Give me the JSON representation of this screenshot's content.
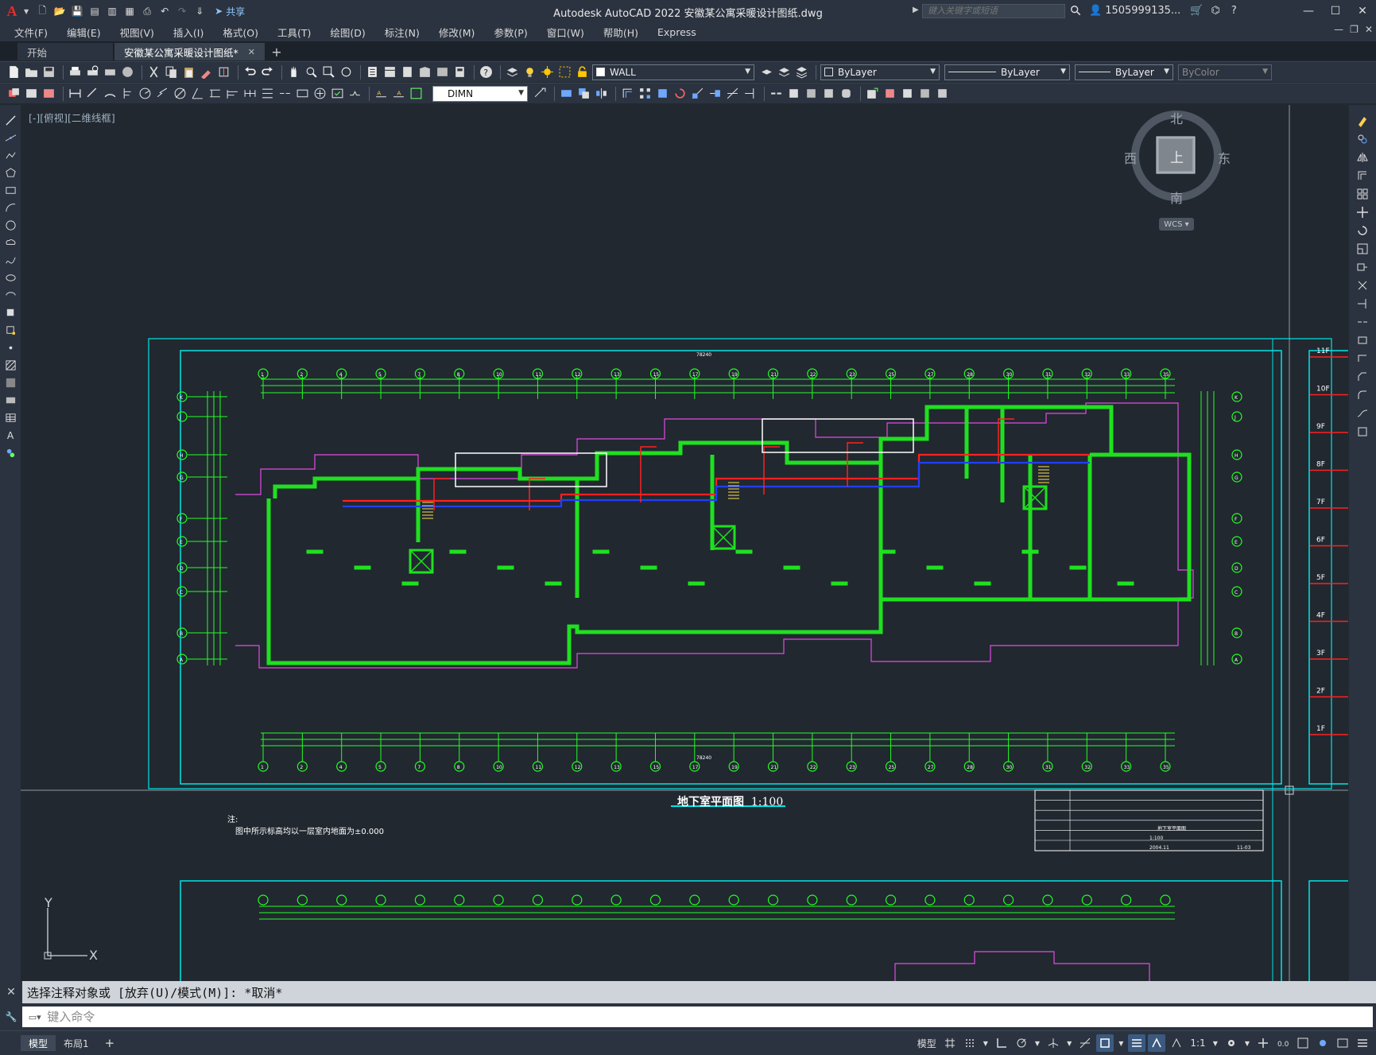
{
  "app": {
    "logo": "A",
    "title": "Autodesk AutoCAD 2022    安徽某公寓采暖设计图纸.dwg",
    "share_label": "共享",
    "search_placeholder": "键入关键字或短语",
    "user": "1505999135...",
    "quick_access_icons": [
      "new-icon",
      "open-icon",
      "save-icon",
      "save-as-icon",
      "open-web-icon",
      "save-web-icon",
      "plot-icon",
      "undo-icon",
      "redo-icon",
      "customize-icon"
    ]
  },
  "menu": {
    "items": [
      "文件(F)",
      "编辑(E)",
      "视图(V)",
      "插入(I)",
      "格式(O)",
      "工具(T)",
      "绘图(D)",
      "标注(N)",
      "修改(M)",
      "参数(P)",
      "窗口(W)",
      "帮助(H)",
      "Express"
    ]
  },
  "tabs": {
    "items": [
      {
        "label": "开始",
        "active": false
      },
      {
        "label": "安徽某公寓采暖设计图纸*",
        "active": true
      }
    ],
    "add_label": "+"
  },
  "toolbar": {
    "layer_value": "WALL",
    "color_value": "ByLayer",
    "linetype_value": "ByLayer",
    "lineweight_value": "ByLayer",
    "plotstyle_value": "ByColor",
    "dimstyle_value": "DIMN"
  },
  "canvas": {
    "view_label": "[-][俯视][二维线框]",
    "viewcube": {
      "north": "北",
      "south": "南",
      "east": "东",
      "west": "西",
      "top": "上",
      "wcs": "WCS"
    },
    "ucs": {
      "x": "X",
      "y": "Y"
    },
    "drawing": {
      "title": "地下室平面图",
      "scale": "1:100",
      "note_title": "注:",
      "note_text": "图中所示标高均以一层室内地面为±0.000",
      "total_dim": "78240",
      "axis_top": [
        "1",
        "2",
        "4",
        "5",
        "7",
        "8",
        "10",
        "11",
        "12",
        "13",
        "15",
        "17",
        "19",
        "21",
        "22",
        "23",
        "25",
        "27",
        "28",
        "30",
        "31",
        "32",
        "33",
        "35"
      ],
      "axis_left": [
        "K",
        "J",
        "H",
        "G",
        "F",
        "E",
        "D",
        "C",
        "B",
        "A"
      ],
      "floor_labels": [
        "11F",
        "10F",
        "9F",
        "8F",
        "7F",
        "6F",
        "5F",
        "4F",
        "3F",
        "2F",
        "1F"
      ],
      "title_block": {
        "scale": "1:100",
        "date": "2004.11",
        "drawing_no": "11-03",
        "sheet_name": "地下室平面图"
      }
    }
  },
  "command": {
    "history": "选择注释对象或 [放弃(U)/模式(M)]: *取消*",
    "placeholder": "键入命令"
  },
  "status": {
    "layouts": [
      "模型",
      "布局1"
    ],
    "add_layout": "+",
    "model_label": "模型",
    "scale_label": "1:1"
  },
  "colors": {
    "background": "#212830",
    "wall": "#1fe01f",
    "frame": "#00e5e5",
    "magenta": "#e24be2",
    "pipe_red": "#ff2020",
    "pipe_blue": "#2040ff",
    "dim": "#22ff22"
  }
}
